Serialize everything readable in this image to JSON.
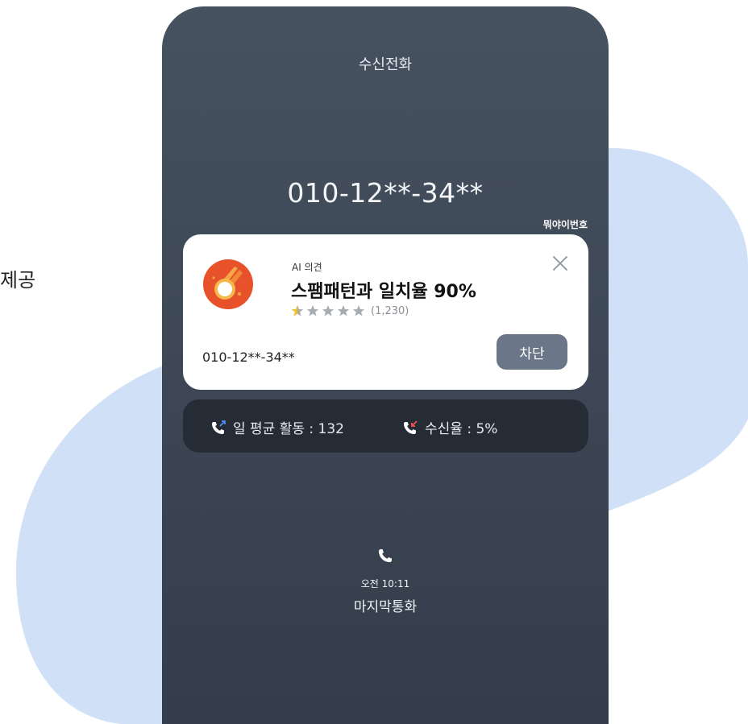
{
  "left_text": "제공",
  "call_screen": {
    "title": "수신전화",
    "number": "010-12**-34**",
    "brand": "뭐야이번호"
  },
  "ai_card": {
    "label": "AI 의견",
    "headline": "스팸패턴과 일치율 90%",
    "rating": 0.5,
    "rating_max": 5,
    "rating_count": "(1,230)",
    "number": "010-12**-34**",
    "block_label": "차단",
    "close_icon": "close-icon"
  },
  "stats": {
    "daily_activity": "일 평균 활동 : 132",
    "answer_rate": "수신율 : 5%"
  },
  "last_call": {
    "time": "오전 10:11",
    "label": "마지막통화"
  },
  "colors": {
    "phone_bg": "#3e4856",
    "blob": "#cfe0f7",
    "block_button": "#6b7689",
    "stats_bar": "#262c36",
    "logo_orange": "#e8522a",
    "star_filled": "#f4c21e",
    "star_empty": "#a7abb2"
  }
}
